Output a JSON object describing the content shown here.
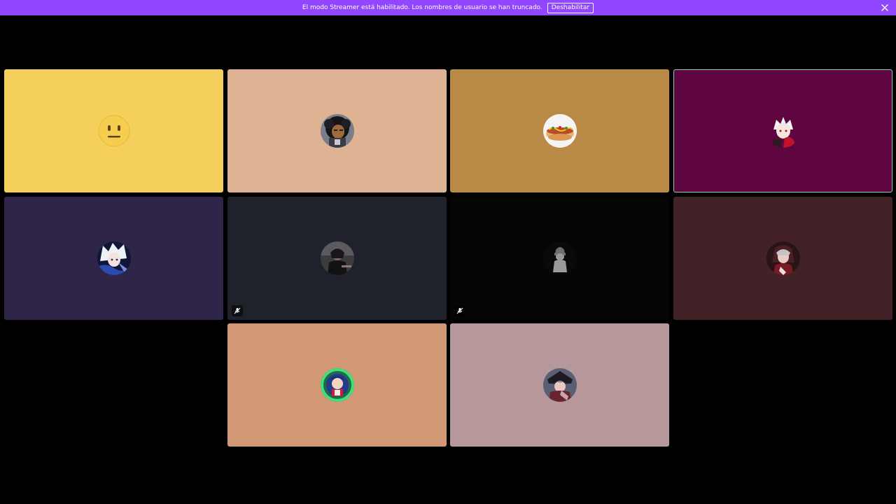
{
  "banner": {
    "message": "El modo Streamer está habilitado. Los nombres de usuario se han truncado.",
    "disable_label": "Deshabilitar",
    "close_icon": "close-icon",
    "color": "#9146ff"
  },
  "participants": [
    {
      "bg": "#f5cf5c",
      "avatar": "neutral-face-emoji",
      "muted": false,
      "speaking": false
    },
    {
      "bg": "#ddb393",
      "avatar": "curly-hair-character",
      "muted": false,
      "speaking": false
    },
    {
      "bg": "#b98a46",
      "avatar": "hotdog",
      "muted": false,
      "speaking": false
    },
    {
      "bg": "#5f0640",
      "avatar": "white-hair-anime-character",
      "muted": false,
      "speaking": true
    },
    {
      "bg": "#2f2548",
      "avatar": "white-hair-anime-character-blue",
      "muted": false,
      "speaking": false
    },
    {
      "bg": "#1f222a",
      "avatar": "dark-figure",
      "muted": true,
      "speaking": false
    },
    {
      "bg": "#050505",
      "avatar": "default-silhouette",
      "muted": true,
      "speaking": false
    },
    {
      "bg": "#422227",
      "avatar": "red-anime-character",
      "muted": false,
      "speaking": false
    },
    {
      "bg": "#d39977",
      "avatar": "cartoon-character-green-ring",
      "muted": false,
      "speaking": false
    },
    {
      "bg": "#b6979a",
      "avatar": "hooded-character",
      "muted": false,
      "speaking": false
    }
  ]
}
